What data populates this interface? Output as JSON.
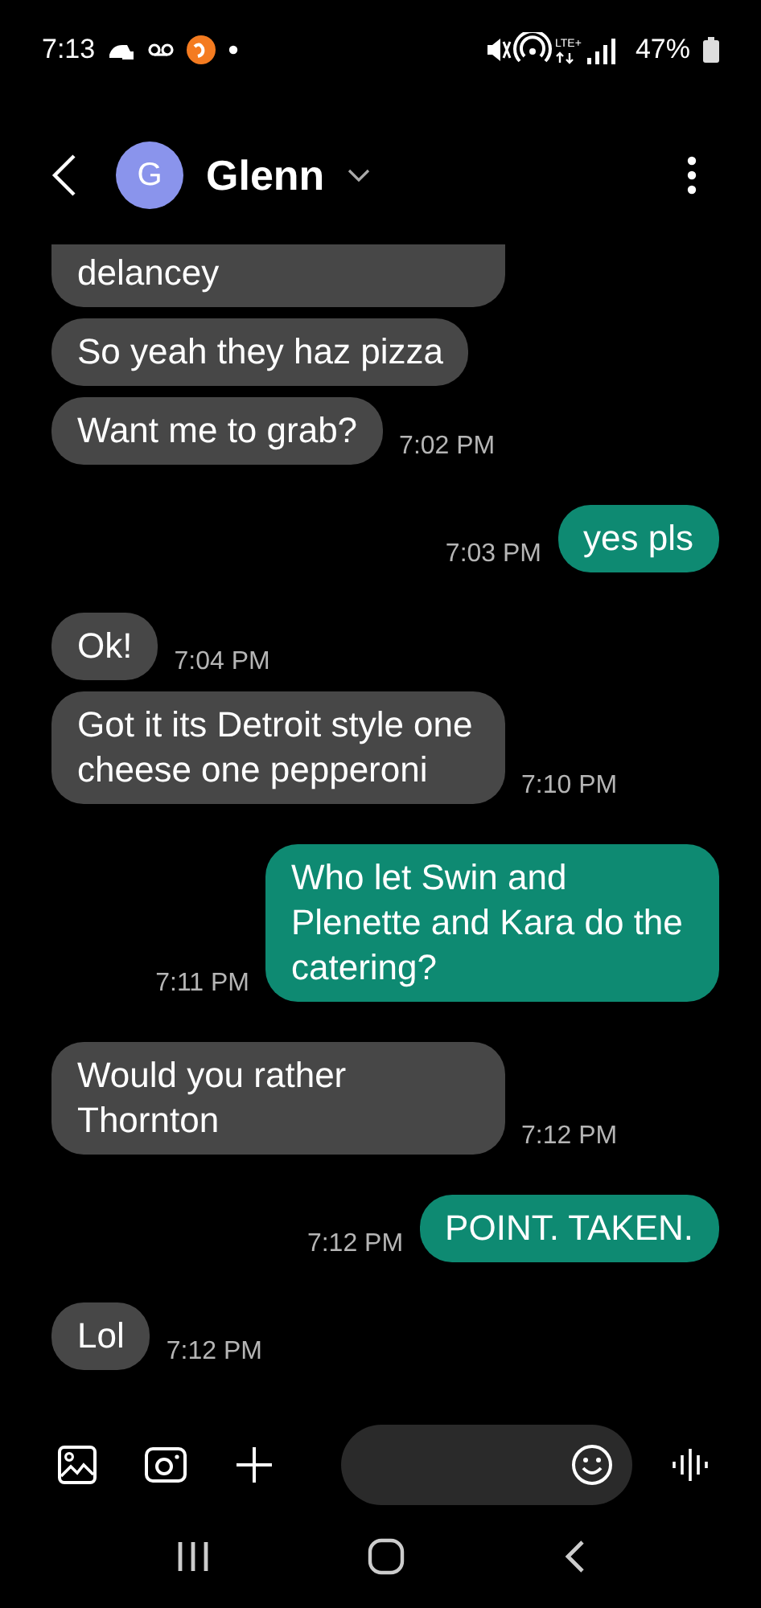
{
  "status_bar": {
    "time": "7:13",
    "battery": "47%",
    "network": "LTE+"
  },
  "header": {
    "avatar_letter": "G",
    "name": "Glenn"
  },
  "messages": [
    {
      "kind": "incoming",
      "text": "delancey",
      "cut_top": true
    },
    {
      "kind": "incoming",
      "text": "So yeah they haz pizza"
    },
    {
      "kind": "incoming",
      "text": "Want me to grab?",
      "time": "7:02 PM"
    },
    {
      "kind": "outgoing",
      "text": "yes pls",
      "time": "7:03 PM"
    },
    {
      "kind": "incoming",
      "text": "Ok!",
      "time": "7:04 PM"
    },
    {
      "kind": "incoming",
      "text": "Got it its Detroit style one cheese one pepperoni",
      "time": "7:10 PM"
    },
    {
      "kind": "outgoing",
      "text": "Who let Swin and Plenette and Kara do the catering?",
      "time": "7:11 PM"
    },
    {
      "kind": "incoming",
      "text": "Would you rather Thornton",
      "time": "7:12 PM"
    },
    {
      "kind": "outgoing",
      "text": "POINT. TAKEN.",
      "time": "7:12 PM"
    },
    {
      "kind": "incoming",
      "text": "Lol",
      "time": "7:12 PM"
    }
  ]
}
